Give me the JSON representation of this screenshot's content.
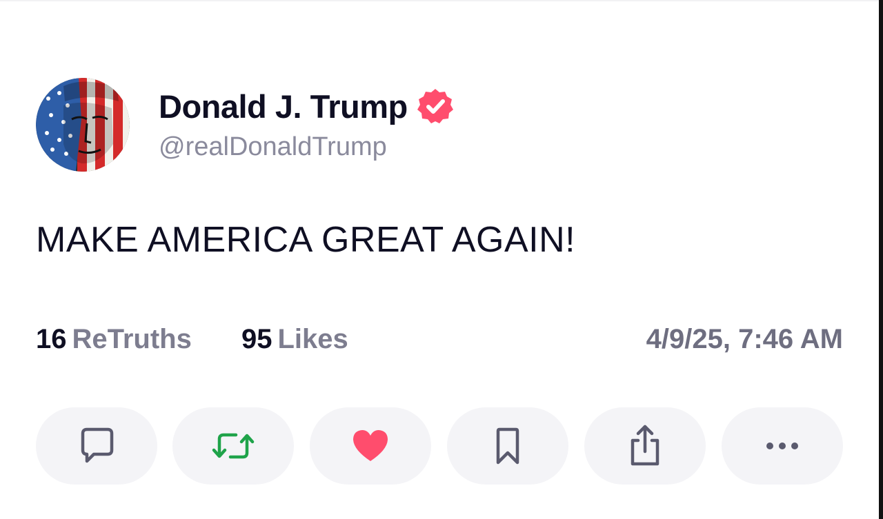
{
  "post": {
    "author": {
      "display_name": "Donald J. Trump",
      "handle": "@realDonaldTrump",
      "verified": true,
      "avatar_icon": "avatar-flag-face"
    },
    "text": "MAKE AMERICA GREAT AGAIN!",
    "stats": {
      "retruths_count": "16",
      "retruths_label": "ReTruths",
      "likes_count": "95",
      "likes_label": "Likes"
    },
    "timestamp": "4/9/25, 7:46 AM"
  },
  "actions": [
    {
      "icon": "comment-icon"
    },
    {
      "icon": "retruth-icon",
      "color": "#1fa34a"
    },
    {
      "icon": "heart-icon",
      "color": "#ff4d6d"
    },
    {
      "icon": "bookmark-icon"
    },
    {
      "icon": "share-icon"
    },
    {
      "icon": "more-icon"
    }
  ],
  "colors": {
    "verified_badge": "#ff4d6d",
    "text_primary": "#0f0f23",
    "text_secondary": "#8a8a9c",
    "action_bg": "#f4f4f7"
  }
}
